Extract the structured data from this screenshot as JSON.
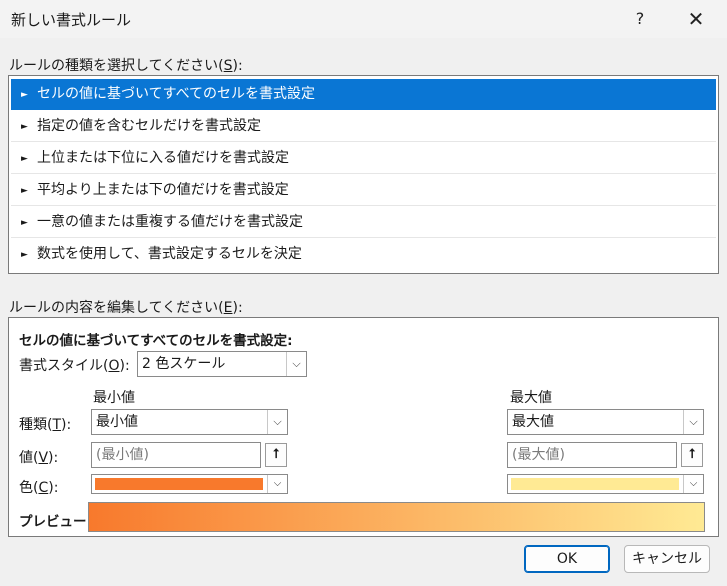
{
  "window": {
    "title": "新しい書式ルール",
    "help_label": "?",
    "close_label": "✕"
  },
  "rule_type": {
    "heading_prefix": "ルールの種類を選択してください(",
    "heading_key": "S",
    "heading_suffix": "):",
    "items": [
      {
        "label": "セルの値に基づいてすべてのセルを書式設定",
        "selected": true
      },
      {
        "label": "指定の値を含むセルだけを書式設定",
        "selected": false
      },
      {
        "label": "上位または下位に入る値だけを書式設定",
        "selected": false
      },
      {
        "label": "平均より上または下の値だけを書式設定",
        "selected": false
      },
      {
        "label": "一意の値または重複する値だけを書式設定",
        "selected": false
      },
      {
        "label": "数式を使用して、書式設定するセルを決定",
        "selected": false
      }
    ]
  },
  "edit": {
    "heading_prefix": "ルールの内容を編集してください(",
    "heading_key": "E",
    "heading_suffix": "):",
    "title": "セルの値に基づいてすべてのセルを書式設定:",
    "style_label_prefix": "書式スタイル(",
    "style_label_key": "O",
    "style_label_suffix": "):",
    "style_value": "2 色スケール",
    "min_header": "最小値",
    "max_header": "最大値",
    "type_label_prefix": "種類(",
    "type_label_key": "T",
    "type_label_suffix": "):",
    "value_label_prefix": "値(",
    "value_label_key": "V",
    "value_label_suffix": "):",
    "color_label_prefix": "色(",
    "color_label_key": "C",
    "color_label_suffix": "):",
    "min_type": "最小値",
    "max_type": "最大値",
    "min_value": "(最小値)",
    "max_value": "(最大値)",
    "min_color": "#f8792c",
    "max_color": "#ffea94",
    "preview_label": "プレビュー:"
  },
  "buttons": {
    "ok": "OK",
    "cancel": "キャンセル"
  },
  "icons": {
    "list_bullet": "►",
    "dropdown": "⌵",
    "upload": "⭡"
  }
}
